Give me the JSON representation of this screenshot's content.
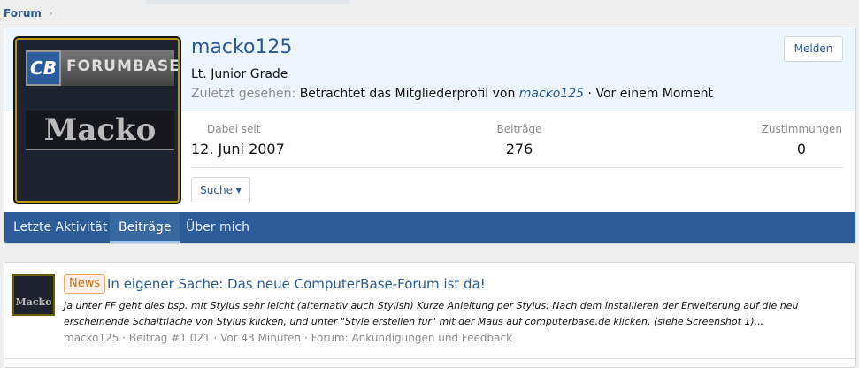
{
  "breadcrumb": {
    "item": "Forum",
    "sep": "›"
  },
  "profile": {
    "avatar_text": {
      "cb": "CB",
      "forumbase": "FORUMBASE",
      "name": "Macko"
    },
    "username": "macko125",
    "rank": "Lt. Junior Grade",
    "last_seen_label": "Zuletzt gesehen:",
    "last_seen_text": "Betrachtet das Mitgliederprofil von",
    "last_seen_link": "macko125",
    "last_seen_time": "· Vor einem Moment",
    "report_button": "Melden",
    "stats": [
      {
        "label": "Dabei seit",
        "value": "12. Juni 2007"
      },
      {
        "label": "Beiträge",
        "value": "276"
      },
      {
        "label": "Zustimmungen",
        "value": "0"
      }
    ],
    "search_button": "Suche ▾",
    "tabs": [
      "Letzte Aktivität",
      "Beiträge",
      "Über mich"
    ],
    "active_tab": "Beiträge"
  },
  "post": {
    "avatar_text": "Macko",
    "badge": "News",
    "title": "In eigener Sache: Das neue ComputerBase-Forum ist da!",
    "snippet": "Ja unter FF geht dies bsp. mit Stylus sehr leicht (alternativ auch Stylish) Kurze Anleitung per Stylus: Nach dem installieren der Erweiterung auf die neu erscheinende Schaltfläche von Stylus klicken, und unter \"Style erstellen für\" mit der Maus auf computerbase.de klicken. (siehe Screenshot 1)...",
    "meta": "macko125 · Beitrag #1.021 · Vor 43 Minuten · Forum: Ankündigungen und Feedback"
  }
}
